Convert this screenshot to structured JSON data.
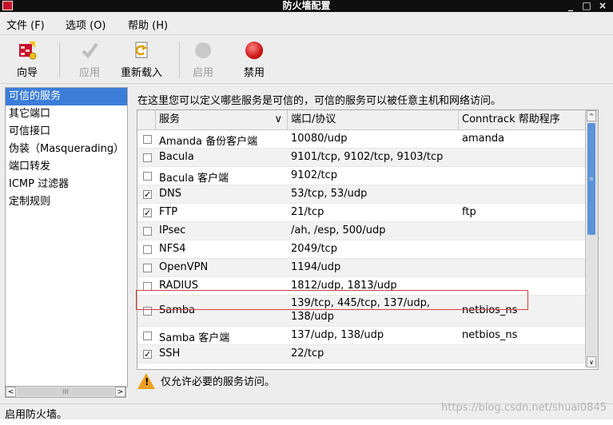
{
  "window": {
    "title": "防火墙配置",
    "controls": {
      "minimize": "_",
      "maximize": "□",
      "close": "×"
    }
  },
  "menu": [
    "文件 (F)",
    "选项 (O)",
    "帮助 (H)"
  ],
  "toolbar": {
    "wizard": {
      "label": "向导",
      "icon": "wizard-icon",
      "enabled": true
    },
    "apply": {
      "label": "应用",
      "icon": "checkmark-icon",
      "enabled": false
    },
    "reload": {
      "label": "重新载入",
      "icon": "reload-icon",
      "enabled": true
    },
    "enable": {
      "label": "启用",
      "icon": "enable-circle-icon",
      "enabled": false
    },
    "disable": {
      "label": "禁用",
      "icon": "disable-red-circle-icon",
      "enabled": true
    }
  },
  "nav": {
    "items": [
      "可信的服务",
      "其它端口",
      "可信接口",
      "伪装（Masquerading）",
      "端口转发",
      "ICMP 过滤器",
      "定制规则"
    ],
    "selected_index": 0,
    "scroll_thumb": "III",
    "scroll_left": "<",
    "scroll_right": ">"
  },
  "description": "在这里您可以定义哪些服务是可信的，可信的服务可以被任意主机和网络访问。",
  "table": {
    "headers": {
      "service": "服务",
      "port": "端口/协议",
      "conntrack": "Conntrack 帮助程序"
    },
    "sort_indicator": "∨",
    "rows": [
      {
        "checked": false,
        "service": "Amanda 备份客户端",
        "port": "10080/udp",
        "conntrack": "amanda"
      },
      {
        "checked": false,
        "service": "Bacula",
        "port": "9101/tcp, 9102/tcp, 9103/tcp",
        "conntrack": ""
      },
      {
        "checked": false,
        "service": "Bacula 客户端",
        "port": "9102/tcp",
        "conntrack": ""
      },
      {
        "checked": true,
        "service": "DNS",
        "port": "53/tcp, 53/udp",
        "conntrack": ""
      },
      {
        "checked": true,
        "service": "FTP",
        "port": "21/tcp",
        "conntrack": "ftp"
      },
      {
        "checked": false,
        "service": "IPsec",
        "port": "/ah, /esp, 500/udp",
        "conntrack": ""
      },
      {
        "checked": false,
        "service": "NFS4",
        "port": "2049/tcp",
        "conntrack": ""
      },
      {
        "checked": false,
        "service": "OpenVPN",
        "port": "1194/udp",
        "conntrack": ""
      },
      {
        "checked": false,
        "service": "RADIUS",
        "port": "1812/udp, 1813/udp",
        "conntrack": ""
      },
      {
        "checked": false,
        "service": "Samba",
        "port": "139/tcp, 445/tcp, 137/udp,",
        "port2": "138/udp",
        "conntrack": "netbios_ns"
      },
      {
        "checked": false,
        "service": "Samba 客户端",
        "port": "137/udp, 138/udp",
        "conntrack": "netbios_ns"
      },
      {
        "checked": true,
        "service": "SSH",
        "port": "22/tcp",
        "conntrack": ""
      }
    ],
    "check_mark": "✓",
    "scroll_up": "^",
    "scroll_down": "∨",
    "scroll_grip": "≡"
  },
  "warning": {
    "mark": "!",
    "text": "仅允许必要的服务访问。"
  },
  "status": "启用防火墙。",
  "watermark": "https://blog.csdn.net/shuai0845",
  "colors": {
    "selection": "#3b7dd8",
    "highlight_box": "#d04040",
    "warning": "#f0a020",
    "disable_red": "#e01010"
  }
}
